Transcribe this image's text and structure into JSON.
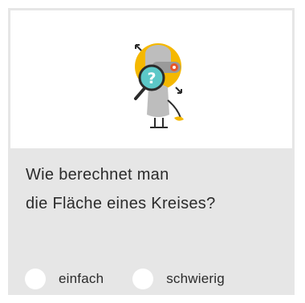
{
  "card": {
    "question_line1": "Wie berechnet man",
    "question_line2": "die Fläche eines Kreises?",
    "illustration": {
      "icon": "robot-detective-with-magnifier-icon",
      "accent_color": "#f5b800",
      "body_color": "#bdbdbd",
      "lens_color": "#5cc8c8",
      "eye_color": "#e8552a"
    },
    "options": [
      {
        "label": "einfach",
        "selected": false
      },
      {
        "label": "schwierig",
        "selected": false
      }
    ]
  }
}
